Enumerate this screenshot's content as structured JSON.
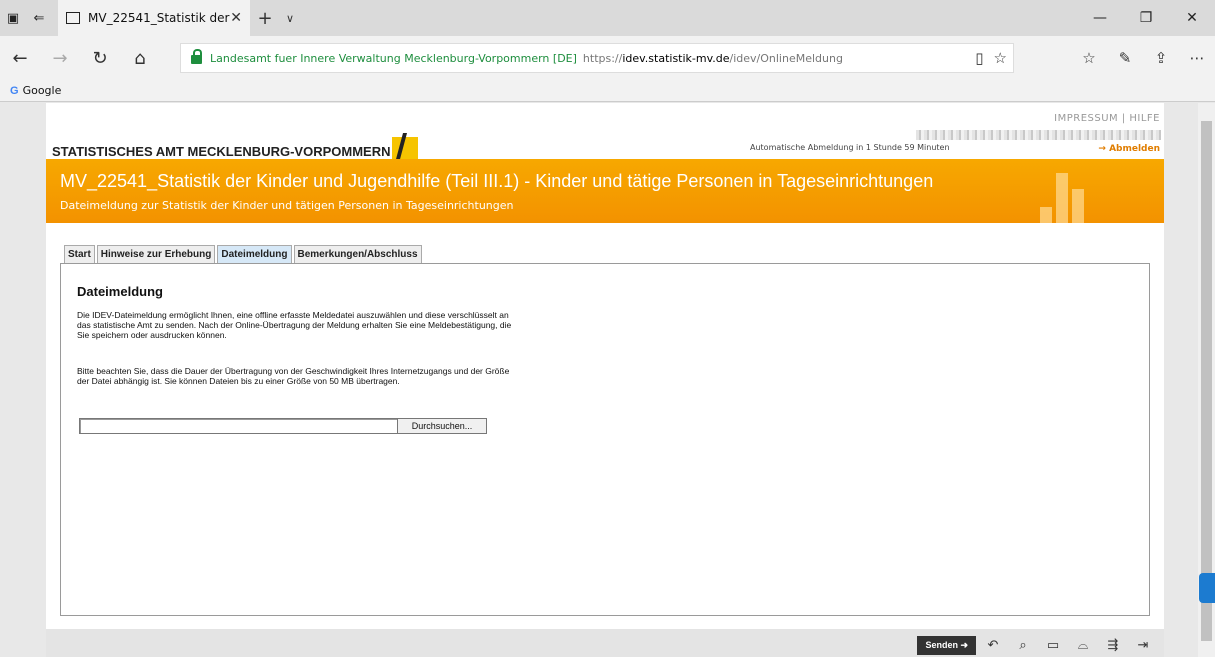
{
  "browser": {
    "tab_title": "MV_22541_Statistik der",
    "url_org": "Landesamt fuer Innere Verwaltung Mecklenburg-Vorpommern [DE]",
    "url_scheme": "https://",
    "url_host": "idev.statistik-mv.de",
    "url_path": "/idev/OnlineMeldung",
    "favorite": "Google"
  },
  "header": {
    "links": "IMPRESSUM | HILFE",
    "logo_text": "STATISTISCHES AMT MECKLENBURG-VORPOMMERN",
    "logout_note": "Automatische Abmeldung in 1 Stunde 59 Minuten",
    "logout_link": "→ Abmelden"
  },
  "banner": {
    "title": "MV_22541_Statistik der Kinder und Jugendhilfe (Teil III.1) - Kinder und tätige Personen in Tageseinrichtungen",
    "subtitle": "Dateimeldung zur Statistik der Kinder und tätigen Personen in Tageseinrichtungen"
  },
  "tabs": [
    {
      "label": "Start"
    },
    {
      "label": "Hinweise zur Erhebung"
    },
    {
      "label": "Dateimeldung"
    },
    {
      "label": "Bemerkungen/Abschluss"
    }
  ],
  "content": {
    "heading": "Dateimeldung",
    "para1": "Die IDEV-Dateimeldung ermöglicht Ihnen, eine offline erfasste Meldedatei auszuwählen und diese verschlüsselt an das statistische Amt zu senden. Nach der Online-Übertragung der Meldung erhalten Sie eine Meldebestätigung, die Sie speichern oder ausdrucken können.",
    "para2": "Bitte beachten Sie, dass die Dauer der Übertragung von der Geschwindigkeit Ihres Internetzugangs und der Größe der Datei abhängig ist. Sie können Dateien bis zu einer Größe von 50 MB übertragen.",
    "file_value": "",
    "browse_label": "Durchsuchen..."
  },
  "footer": {
    "send_label": "Senden ➜"
  }
}
